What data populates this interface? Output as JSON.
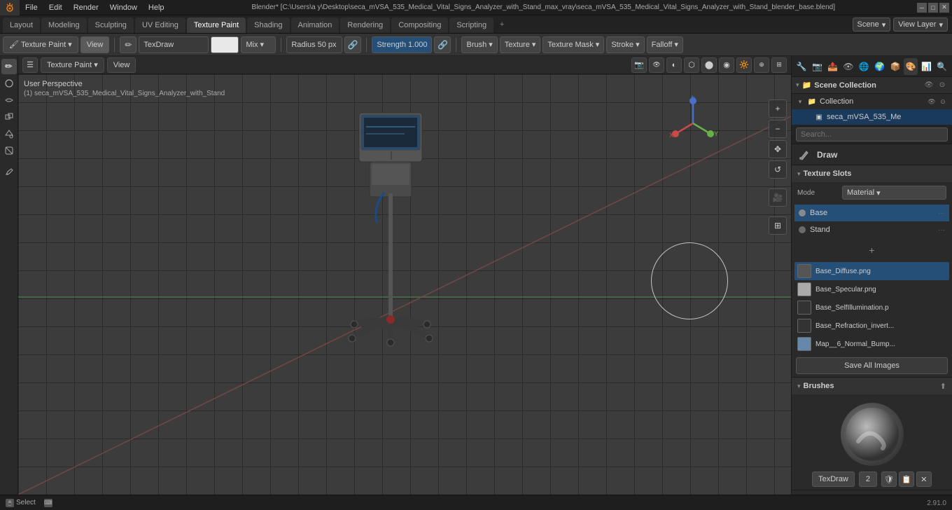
{
  "window": {
    "title": "Blender* [C:\\Users\\a y\\Desktop\\seca_mVSA_535_Medical_Vital_Signs_Analyzer_with_Stand_max_vray\\seca_mVSA_535_Medical_Vital_Signs_Analyzer_with_Stand_blender_base.blend]",
    "version": "2.91.0"
  },
  "menu": {
    "items": [
      "Blender",
      "File",
      "Edit",
      "Render",
      "Window",
      "Help"
    ]
  },
  "workspace_tabs": {
    "tabs": [
      "Layout",
      "Modeling",
      "Sculpting",
      "UV Editing",
      "Texture Paint",
      "Shading",
      "Animation",
      "Rendering",
      "Compositing",
      "Scripting"
    ],
    "active": "Texture Paint",
    "plus_label": "+",
    "scene_label": "Scene",
    "view_layer_label": "View Layer"
  },
  "toolbar": {
    "brush_icon_label": "✏",
    "tool_label": "TexDraw",
    "mix_label": "Mix",
    "radius_label": "Radius",
    "radius_value": "50 px",
    "strength_label": "Strength",
    "strength_value": "1.000",
    "brush_label": "Brush",
    "texture_label": "Texture",
    "texture_mask_label": "Texture Mask",
    "stroke_label": "Stroke",
    "falloff_label": "Falloff"
  },
  "viewport": {
    "mode_label": "Texture Paint",
    "view_label": "View",
    "perspective_label": "User Perspective",
    "object_label": "(1) seca_mVSA_535_Medical_Vital_Signs_Analyzer_with_Stand"
  },
  "right_panel": {
    "scene_collection_label": "Scene Collection",
    "collection_label": "Collection",
    "object_label": "seca_mVSA_535_Me",
    "search_placeholder": "Search...",
    "draw_label": "Draw",
    "texture_slots": {
      "title": "Texture Slots",
      "mode_label": "Mode",
      "mode_value": "Material",
      "slots": [
        "Base",
        "Stand"
      ],
      "active_slot": "Base"
    },
    "texture_images": {
      "images": [
        {
          "name": "Base_Diffuse.png",
          "color": "#555"
        },
        {
          "name": "Base_Specular.png",
          "color": "#aaa"
        },
        {
          "name": "Base_SelfIllumination.p",
          "color": "#333"
        },
        {
          "name": "Base_Refraction_invert...",
          "color": "#333"
        },
        {
          "name": "Map__6_Normal_Bump...",
          "color": "#6688aa"
        }
      ],
      "add_label": "+"
    },
    "save_all_images_label": "Save All Images",
    "brushes": {
      "title": "Brushes",
      "brush_name": "TexDraw",
      "brush_number": "2"
    }
  },
  "status_bar": {
    "select_label": "Select",
    "mouse_icon": "🖱",
    "keyboard_icon": "⌨"
  }
}
